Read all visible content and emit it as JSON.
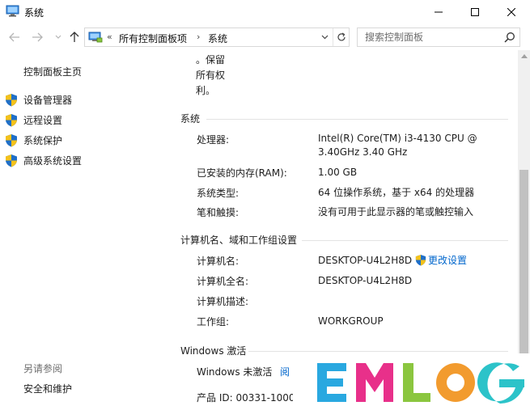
{
  "window": {
    "title": "系统"
  },
  "address": {
    "chevrons": "«",
    "crumb1": "所有控制面板项",
    "separator": "›",
    "crumb2": "系统"
  },
  "search": {
    "placeholder": "搜索控制面板"
  },
  "left": {
    "home": "控制面板主页",
    "links": [
      "设备管理器",
      "远程设置",
      "系统保护",
      "高级系统设置"
    ],
    "see_also": "另请参阅",
    "security": "安全和维护"
  },
  "content": {
    "copyright": [
      "。保留",
      "所有权",
      "利。"
    ],
    "system": {
      "title": "系统",
      "processor_label": "处理器:",
      "processor_line1": "Intel(R) Core(TM) i3-4130 CPU @",
      "processor_line2": "3.40GHz   3.40 GHz",
      "ram_label": "已安装的内存(RAM):",
      "ram_value": "1.00 GB",
      "type_label": "系统类型:",
      "type_value": "64 位操作系统，基于 x64 的处理器",
      "pen_label": "笔和触摸:",
      "pen_value": "没有可用于此显示器的笔或触控输入"
    },
    "computer": {
      "title": "计算机名、域和工作组设置",
      "name_label": "计算机名:",
      "name_value": "DESKTOP-U4L2H8D",
      "change_link": "更改设置",
      "fullname_label": "计算机全名:",
      "fullname_value": "DESKTOP-U4L2H8D",
      "desc_label": "计算机描述:",
      "workgroup_label": "工作组:",
      "workgroup_value": "WORKGROUP"
    },
    "activation": {
      "title": "Windows 激活",
      "status": "Windows 未激活",
      "link": "阅",
      "product_id": "产品 ID: 00331-1000"
    }
  },
  "watermark": {
    "text": "EMLOG",
    "colors": [
      "#29a8e0",
      "#e8308a",
      "#8bc63f",
      "#f29b2e",
      "#2cc3c9"
    ]
  },
  "colors": {
    "link": "#0066cc",
    "muted": "#6d6d6d",
    "shield_blue": "#1f6fc8",
    "shield_yellow": "#f5c21b"
  }
}
